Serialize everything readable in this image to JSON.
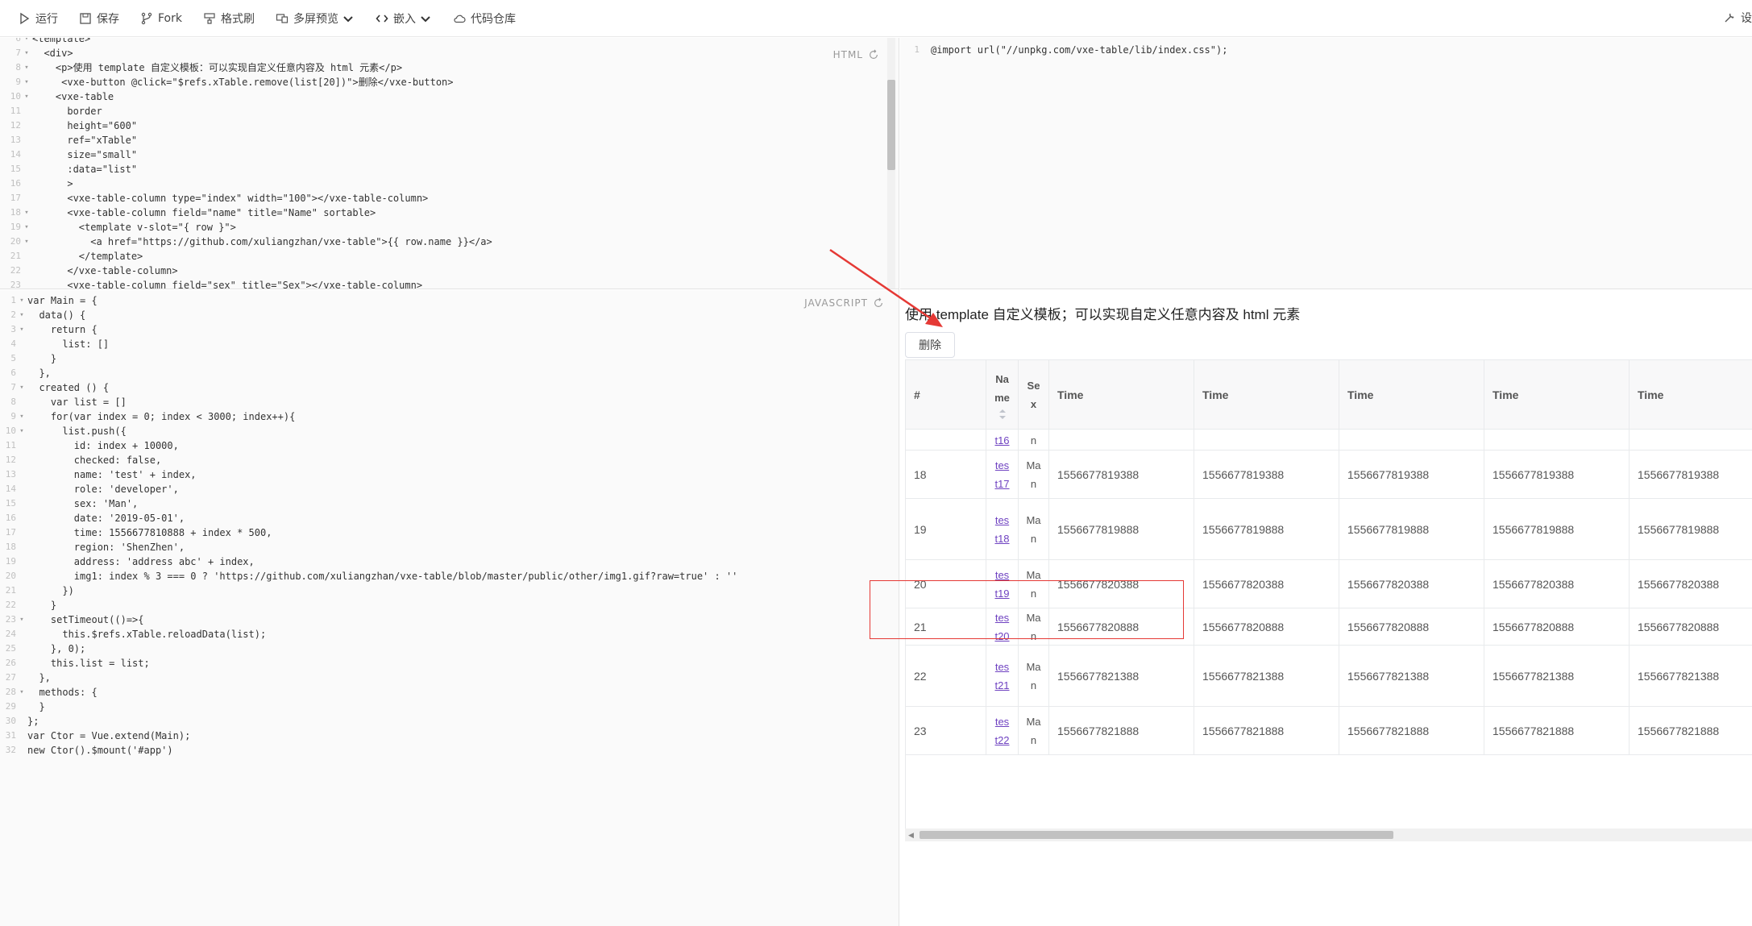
{
  "toolbar": {
    "run": "运行",
    "save": "保存",
    "fork": "Fork",
    "format": "格式刷",
    "preview": "多屏预览",
    "embed": "嵌入",
    "repo": "代码仓库",
    "settings": "设"
  },
  "html_pane": {
    "label": "HTML",
    "lines": [
      {
        "n": "6",
        "f": "▾",
        "t": "<template>"
      },
      {
        "n": "7",
        "f": "▾",
        "t": "  <div>"
      },
      {
        "n": "8",
        "f": "▾",
        "t": "    <p>使用 template 自定义模板：可以实现自定义任意内容及 html 元素</p>"
      },
      {
        "n": "9",
        "f": "▾",
        "t": "     <vxe-button @click=\"$refs.xTable.remove(list[20])\">删除</vxe-button>"
      },
      {
        "n": "10",
        "f": "▾",
        "t": "    <vxe-table"
      },
      {
        "n": "11",
        "f": "",
        "t": "      border"
      },
      {
        "n": "12",
        "f": "",
        "t": "      height=\"600\""
      },
      {
        "n": "13",
        "f": "",
        "t": "      ref=\"xTable\""
      },
      {
        "n": "14",
        "f": "",
        "t": "      size=\"small\""
      },
      {
        "n": "15",
        "f": "",
        "t": "      :data=\"list\""
      },
      {
        "n": "16",
        "f": "",
        "t": "      >"
      },
      {
        "n": "17",
        "f": "",
        "t": "      <vxe-table-column type=\"index\" width=\"100\"></vxe-table-column>"
      },
      {
        "n": "18",
        "f": "▾",
        "t": "      <vxe-table-column field=\"name\" title=\"Name\" sortable>"
      },
      {
        "n": "19",
        "f": "▾",
        "t": "        <template v-slot=\"{ row }\">"
      },
      {
        "n": "20",
        "f": "▾",
        "t": "          <a href=\"https://github.com/xuliangzhan/vxe-table\">{{ row.name }}</a>"
      },
      {
        "n": "21",
        "f": "",
        "t": "        </template>"
      },
      {
        "n": "22",
        "f": "",
        "t": "      </vxe-table-column>"
      },
      {
        "n": "23",
        "f": "",
        "t": "      <vxe-table-column field=\"sex\" title=\"Sex\"></vxe-table-column>"
      }
    ]
  },
  "js_pane": {
    "label": "JAVASCRIPT",
    "lines": [
      {
        "n": "1",
        "f": "▾",
        "t": "var Main = {"
      },
      {
        "n": "2",
        "f": "▾",
        "t": "  data() {"
      },
      {
        "n": "3",
        "f": "▾",
        "t": "    return {"
      },
      {
        "n": "4",
        "f": "",
        "t": "      list: []"
      },
      {
        "n": "5",
        "f": "",
        "t": "    }"
      },
      {
        "n": "6",
        "f": "",
        "t": "  },"
      },
      {
        "n": "7",
        "f": "▾",
        "t": "  created () {"
      },
      {
        "n": "8",
        "f": "",
        "t": "    var list = []"
      },
      {
        "n": "9",
        "f": "▾",
        "t": "    for(var index = 0; index < 3000; index++){"
      },
      {
        "n": "10",
        "f": "▾",
        "t": "      list.push({"
      },
      {
        "n": "11",
        "f": "",
        "t": "        id: index + 10000,"
      },
      {
        "n": "12",
        "f": "",
        "t": "        checked: false,"
      },
      {
        "n": "13",
        "f": "",
        "t": "        name: 'test' + index,"
      },
      {
        "n": "14",
        "f": "",
        "t": "        role: 'developer',"
      },
      {
        "n": "15",
        "f": "",
        "t": "        sex: 'Man',"
      },
      {
        "n": "16",
        "f": "",
        "t": "        date: '2019-05-01',"
      },
      {
        "n": "17",
        "f": "",
        "t": "        time: 1556677810888 + index * 500,"
      },
      {
        "n": "18",
        "f": "",
        "t": "        region: 'ShenZhen',"
      },
      {
        "n": "19",
        "f": "",
        "t": "        address: 'address abc' + index,"
      },
      {
        "n": "20",
        "f": "",
        "t": "        img1: index % 3 === 0 ? 'https://github.com/xuliangzhan/vxe-table/blob/master/public/other/img1.gif?raw=true' : ''"
      },
      {
        "n": "21",
        "f": "",
        "t": "      })"
      },
      {
        "n": "22",
        "f": "",
        "t": "    }"
      },
      {
        "n": "23",
        "f": "▾",
        "t": "    setTimeout(()=>{"
      },
      {
        "n": "24",
        "f": "",
        "t": "      this.$refs.xTable.reloadData(list);"
      },
      {
        "n": "25",
        "f": "",
        "t": "    }, 0);"
      },
      {
        "n": "26",
        "f": "",
        "t": "    this.list = list;"
      },
      {
        "n": "27",
        "f": "",
        "t": "  },"
      },
      {
        "n": "28",
        "f": "▾",
        "t": "  methods: {"
      },
      {
        "n": "29",
        "f": "",
        "t": "  }"
      },
      {
        "n": "30",
        "f": "",
        "t": "};"
      },
      {
        "n": "31",
        "f": "",
        "t": "var Ctor = Vue.extend(Main);"
      },
      {
        "n": "32",
        "f": "",
        "t": "new Ctor().$mount('#app')"
      }
    ]
  },
  "css_pane": {
    "lines": [
      {
        "n": "1",
        "f": "",
        "t": "@import url(\"//unpkg.com/vxe-table/lib/index.css\");"
      }
    ]
  },
  "preview": {
    "title": "使用 template 自定义模板；可以实现自定义任意内容及 html 元素",
    "delete_button": "删除",
    "columns": {
      "index": "#",
      "name": "Na me",
      "sex": "Se x",
      "time": "Time"
    },
    "partial_row": {
      "name": "t16",
      "sex": "n"
    },
    "rows": [
      {
        "index": "18",
        "name1": "tes",
        "name2": "t17",
        "sex1": "Ma",
        "sex2": "n",
        "time": "1556677819388"
      },
      {
        "index": "19",
        "name1": "tes",
        "name2": "t18",
        "sex1": "Ma",
        "sex2": "n",
        "time": "1556677819888"
      },
      {
        "index": "20",
        "name1": "tes",
        "name2": "t19",
        "sex1": "Ma",
        "sex2": "n",
        "time": "1556677820388"
      },
      {
        "index": "21",
        "name1": "tes",
        "name2": "t20",
        "sex1": "Ma",
        "sex2": "n",
        "time": "1556677820888"
      },
      {
        "index": "22",
        "name1": "tes",
        "name2": "t21",
        "sex1": "Ma",
        "sex2": "n",
        "time": "1556677821388"
      },
      {
        "index": "23",
        "name1": "tes",
        "name2": "t22",
        "sex1": "Ma",
        "sex2": "n",
        "time": "1556677821888"
      }
    ]
  },
  "colors": {
    "accent_red": "#e53935",
    "link": "#6f42c1"
  }
}
